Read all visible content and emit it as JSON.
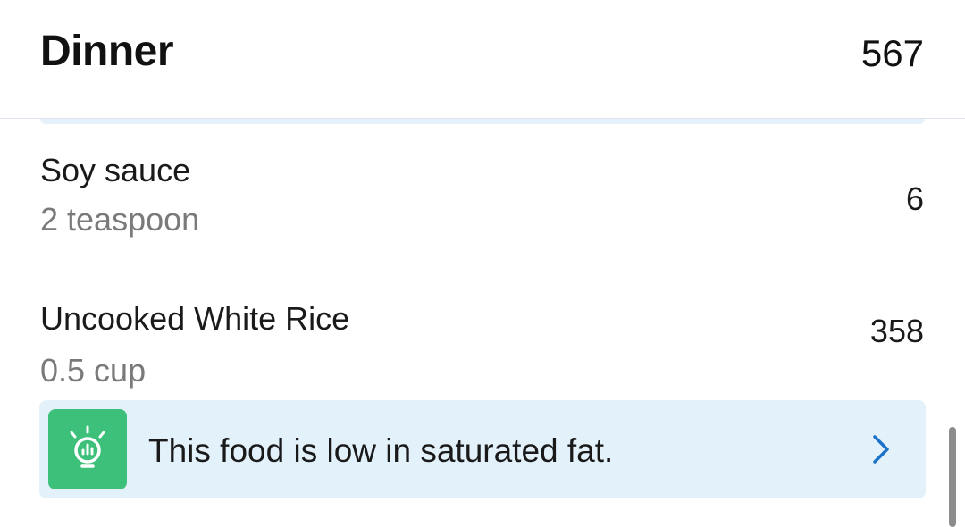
{
  "meal": {
    "title": "Dinner",
    "total_calories": "567"
  },
  "foods": [
    {
      "name": "Soy sauce",
      "amount": "2 teaspoon",
      "calories": "6"
    },
    {
      "name": "Uncooked White Rice",
      "amount": "0.5 cup",
      "calories": "358"
    }
  ],
  "insight": {
    "text": "This food is low in saturated fat.",
    "icon": "lightbulb-icon",
    "chevron": "chevron-right-icon"
  },
  "colors": {
    "accent": "#1a73c9",
    "insight_bg": "#e3f1fb",
    "insight_icon_bg": "#3cc07a",
    "secondary_text": "#7a7a7a"
  }
}
